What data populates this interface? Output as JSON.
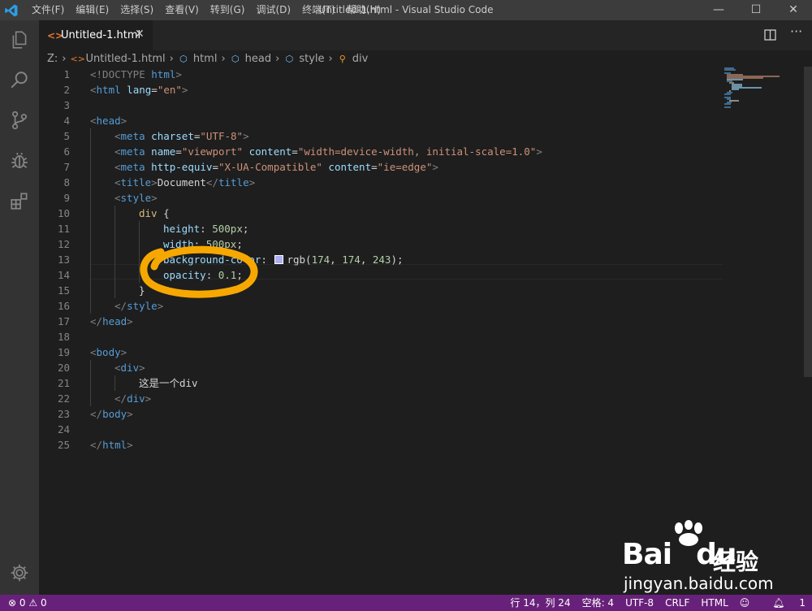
{
  "titlebar": {
    "menu": [
      "文件(F)",
      "编辑(E)",
      "选择(S)",
      "查看(V)",
      "转到(G)",
      "调试(D)",
      "终端(T)",
      "帮助(H)"
    ],
    "window_title": "Untitled-1.html - Visual Studio Code",
    "minimize": "—",
    "maximize": "☐",
    "close": "✕"
  },
  "activity_bar": {
    "icons": [
      "explorer-icon",
      "search-icon",
      "source-control-icon",
      "debug-icon",
      "extensions-icon",
      "settings-gear-icon"
    ]
  },
  "tabs": [
    {
      "label": "Untitled-1.html",
      "icon": "html-file-icon",
      "close": "✕"
    }
  ],
  "editor_actions": {
    "split": "split-editor-icon",
    "more": "···"
  },
  "breadcrumb": [
    "Z:",
    "Untitled-1.html",
    "html",
    "head",
    "style",
    "div"
  ],
  "editor": {
    "line_numbers": [
      "1",
      "2",
      "3",
      "4",
      "5",
      "6",
      "7",
      "8",
      "9",
      "10",
      "11",
      "12",
      "13",
      "14",
      "15",
      "16",
      "17",
      "18",
      "19",
      "20",
      "21",
      "22",
      "23",
      "24",
      "25"
    ],
    "lines": {
      "l1": {
        "a": "<!DOCTYPE ",
        "b": "html",
        "c": ">"
      },
      "l2": {
        "a": "<",
        "b": "html",
        "c": " lang",
        "d": "=",
        "e": "\"en\"",
        "f": ">"
      },
      "l4": {
        "a": "<",
        "b": "head",
        "c": ">"
      },
      "l5": {
        "a": "<",
        "b": "meta",
        "c": " charset",
        "d": "=",
        "e": "\"UTF-8\"",
        "f": ">"
      },
      "l6": {
        "a": "<",
        "b": "meta",
        "c": " name",
        "d": "=",
        "e": "\"viewport\"",
        "f": " content",
        "g": "=",
        "h": "\"width=device-width, initial-scale=1.0\"",
        "i": ">"
      },
      "l7": {
        "a": "<",
        "b": "meta",
        "c": " http-equiv",
        "d": "=",
        "e": "\"X-UA-Compatible\"",
        "f": " content",
        "g": "=",
        "h": "\"ie=edge\"",
        "i": ">"
      },
      "l8": {
        "a": "<",
        "b": "title",
        "c": ">",
        "d": "Document",
        "e": "</",
        "f": "title",
        "g": ">"
      },
      "l9": {
        "a": "<",
        "b": "style",
        "c": ">"
      },
      "l10": {
        "a": "div",
        "b": " {"
      },
      "l11": {
        "a": "height",
        "b": ": ",
        "c": "500px",
        "d": ";"
      },
      "l12": {
        "a": "width",
        "b": ": ",
        "c": "500px",
        "d": ";"
      },
      "l13": {
        "a": "background-color",
        "b": ": ",
        "c": "rgb(",
        "d": "174",
        "e": ", ",
        "f": "174",
        "g": ", ",
        "h": "243",
        "i": ");"
      },
      "l14": {
        "a": "opacity",
        "b": ": ",
        "c": "0.1",
        "d": ";"
      },
      "l15": {
        "a": "}"
      },
      "l16": {
        "a": "</",
        "b": "style",
        "c": ">"
      },
      "l17": {
        "a": "</",
        "b": "head",
        "c": ">"
      },
      "l19": {
        "a": "<",
        "b": "body",
        "c": ">"
      },
      "l20": {
        "a": "<",
        "b": "div",
        "c": ">"
      },
      "l21": {
        "a": "这是一个div"
      },
      "l22": {
        "a": "</",
        "b": "div",
        "c": ">"
      },
      "l23": {
        "a": "</",
        "b": "body",
        "c": ">"
      },
      "l25": {
        "a": "</",
        "b": "html",
        "c": ">"
      }
    },
    "swatch_color": "#aeaef3"
  },
  "statusbar": {
    "errors": "0",
    "warnings": "0",
    "position": "行 14，列 24",
    "spaces": "空格: 4",
    "encoding": "UTF-8",
    "eol": "CRLF",
    "language": "HTML",
    "notifications": "1",
    "background": "#68217a"
  },
  "watermark": {
    "brand": "Bai",
    "brand_du": "du",
    "product": "经验",
    "url": "jingyan.baidu.com"
  }
}
